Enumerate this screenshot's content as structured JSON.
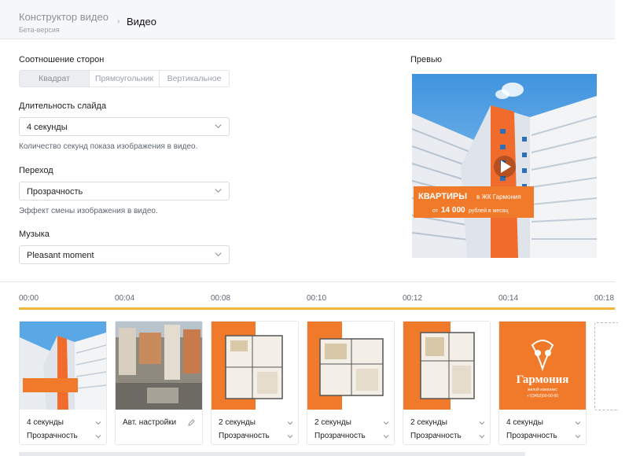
{
  "header": {
    "app_title": "Конструктор видео",
    "app_subtitle": "Бета-версия",
    "separator": "›",
    "current": "Видео"
  },
  "aspect": {
    "label": "Соотношение сторон",
    "options": [
      "Квадрат",
      "Прямоугольник",
      "Вертикальное"
    ],
    "selected": "Квадрат"
  },
  "duration": {
    "label": "Длительность слайда",
    "value": "4 секунды",
    "hint": "Количество секунд показа изображения в видео."
  },
  "transition": {
    "label": "Переход",
    "value": "Прозрачность",
    "hint": "Эффект смены изображения в видео."
  },
  "music": {
    "label": "Музыка",
    "value": "Pleasant moment"
  },
  "preview": {
    "label": "Превью",
    "banner_line1_big": "КВАРТИРЫ",
    "banner_line1_small": "в ЖК Гармония",
    "banner_line2_pre": "от",
    "banner_line2_big": "14 000",
    "banner_line2_post": "рублей в месяц"
  },
  "timeline": {
    "ticks": [
      "00:00",
      "00:04",
      "00:08",
      "00:10",
      "00:12",
      "00:14",
      "00:18"
    ]
  },
  "slides": [
    {
      "duration": "4 секунды",
      "transition": "Прозрачность",
      "kind": "building-banner"
    },
    {
      "duration": "Авт. настройки",
      "transition": "",
      "kind": "aerial"
    },
    {
      "duration": "2 секунды",
      "transition": "Прозрачность",
      "kind": "floorplan"
    },
    {
      "duration": "2 секунды",
      "transition": "Прозрачность",
      "kind": "floorplan"
    },
    {
      "duration": "2 секунды",
      "transition": "Прозрачность",
      "kind": "floorplan"
    },
    {
      "duration": "4 секунды",
      "transition": "Прозрачность",
      "kind": "logo",
      "logo_text": "Гармония",
      "logo_sub": "жилой комплекс",
      "logo_phone": "+7(3452)00-00-00"
    }
  ],
  "colors": {
    "accent_orange": "#f07a2a",
    "timeline_yellow": "#f2b53a",
    "sky": "#5aa7e6"
  }
}
